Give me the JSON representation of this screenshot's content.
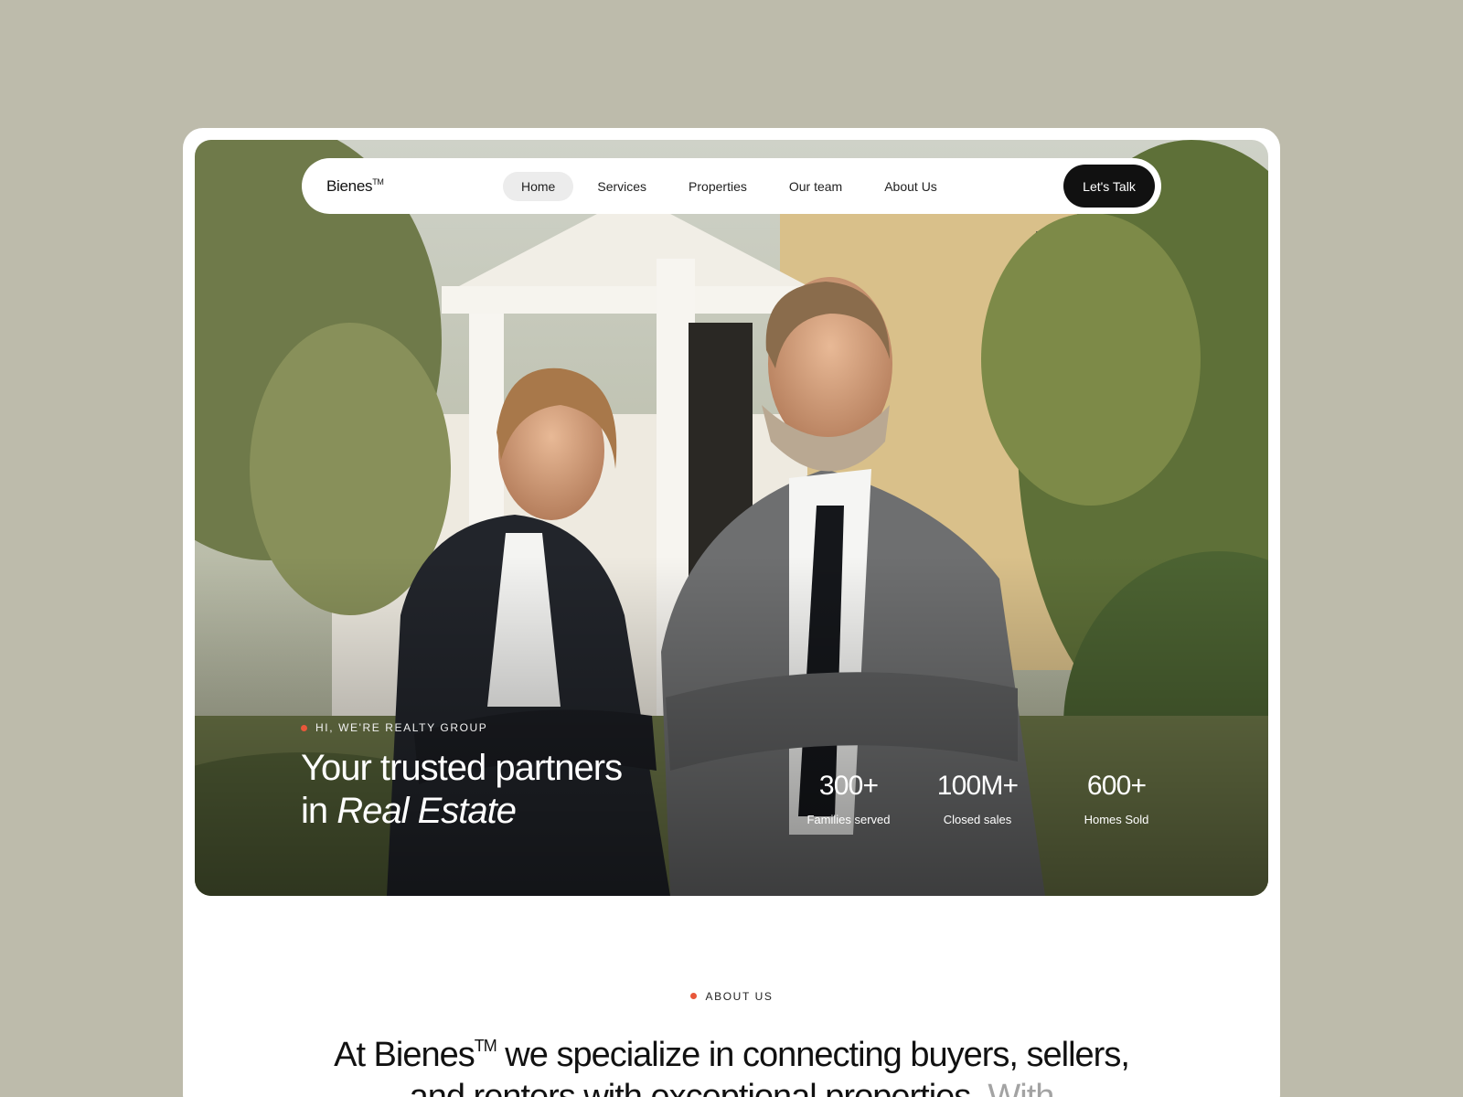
{
  "brand": {
    "name": "Bienes",
    "tm": "TM"
  },
  "nav": {
    "items": [
      {
        "label": "Home",
        "active": true
      },
      {
        "label": "Services",
        "active": false
      },
      {
        "label": "Properties",
        "active": false
      },
      {
        "label": "Our team",
        "active": false
      },
      {
        "label": "About Us",
        "active": false
      }
    ],
    "cta_label": "Let's Talk"
  },
  "hero": {
    "eyebrow": "HI, WE'RE REALTY GROUP",
    "headline_line1": "Your trusted partners",
    "headline_in": "in ",
    "headline_em": "Real Estate",
    "image": "photo of two smiling real estate agents in suits in front of a house",
    "stats": [
      {
        "value": "300+",
        "label": "Families served"
      },
      {
        "value": "100M+",
        "label": "Closed sales"
      },
      {
        "value": "600+",
        "label": "Homes Sold"
      }
    ]
  },
  "about": {
    "eyebrow": "ABOUT US",
    "text_start": "At Bienes",
    "tm": "TM",
    "text_main": " we specialize in connecting buyers, sellers, and renters with exceptional properties. ",
    "text_muted": "With"
  },
  "colors": {
    "page_bg": "#bdbbab",
    "accent_dot": "#e8573a",
    "cta_bg": "#111111"
  }
}
